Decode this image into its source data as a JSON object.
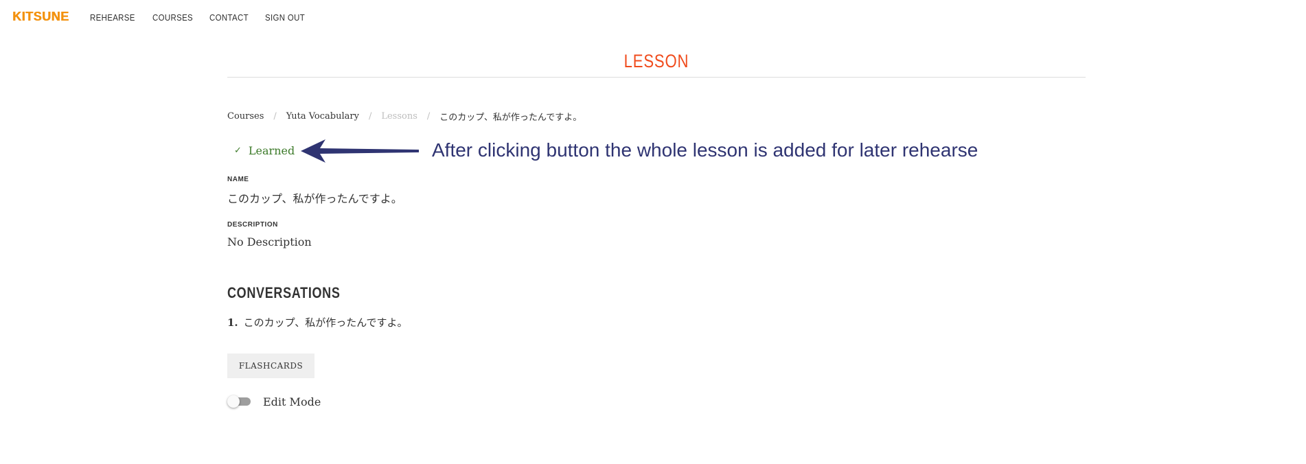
{
  "nav": {
    "logo": "KITSUNE",
    "links": [
      "REHEARSE",
      "COURSES",
      "CONTACT",
      "SIGN OUT"
    ]
  },
  "page": {
    "title": "LESSON"
  },
  "breadcrumb": {
    "items": [
      "Courses",
      "Yuta Vocabulary",
      "Lessons",
      "このカップ、私が作ったんですよ。"
    ],
    "separator": "/"
  },
  "status": {
    "learned_label": "Learned",
    "check_icon": "✓",
    "color": "#3c7a29"
  },
  "annotation": {
    "text": "After clicking button the whole lesson is added for later rehearse",
    "color": "#2f3472"
  },
  "fields": {
    "name_label": "NAME",
    "name_value": "このカップ、私が作ったんですよ。",
    "description_label": "DESCRIPTION",
    "description_value": "No Description"
  },
  "conversations": {
    "title": "CONVERSATIONS",
    "items": [
      {
        "number": "1.",
        "text": "このカップ、私が作ったんですよ。"
      }
    ]
  },
  "actions": {
    "flashcards_label": "FLASHCARDS",
    "edit_mode_label": "Edit Mode",
    "edit_mode_on": false
  },
  "colors": {
    "accent": "#f04b1c",
    "logo": "#f3920f"
  }
}
